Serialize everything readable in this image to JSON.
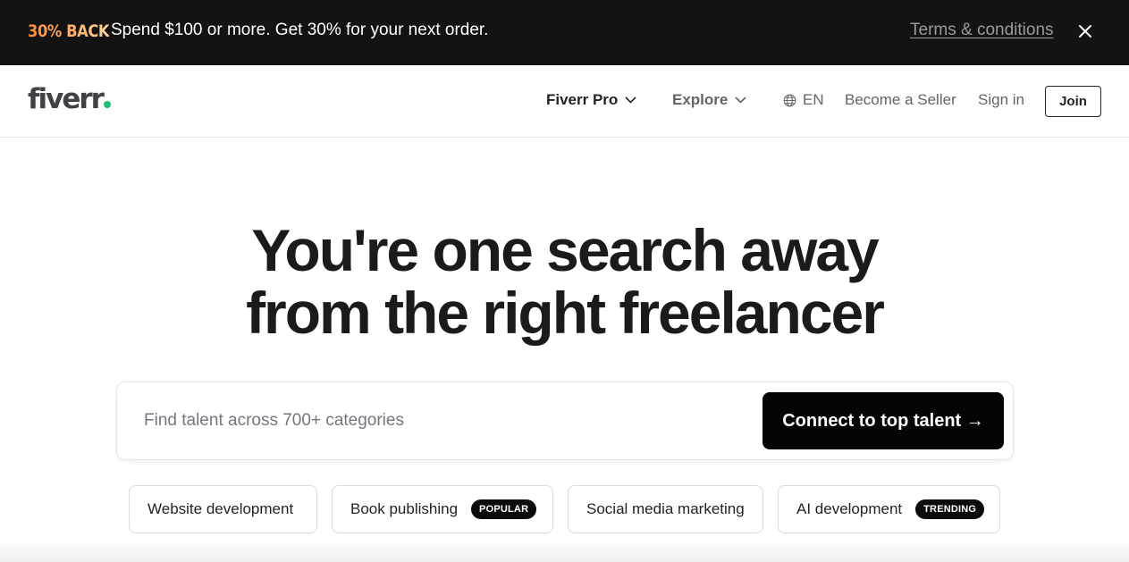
{
  "promo": {
    "badge": "30% BACK",
    "text": "Spend $100 or more. Get 30% for your next order.",
    "terms_link": "Terms & conditions",
    "close_icon": "close-icon"
  },
  "header": {
    "logo": "fiverr",
    "nav": {
      "fiverr_pro": "Fiverr Pro",
      "explore": "Explore",
      "language": "EN",
      "become_seller": "Become a Seller",
      "sign_in": "Sign in",
      "join": "Join"
    }
  },
  "hero": {
    "title_line1": "You're one search away",
    "title_line2": "from the right freelancer"
  },
  "search": {
    "placeholder": "Find talent across 700+ categories",
    "value": "",
    "button_label": "Connect to top talent →"
  },
  "chips": [
    {
      "label": "Website development",
      "badge": ""
    },
    {
      "label": "Book publishing",
      "badge": "POPULAR"
    },
    {
      "label": "Social media marketing",
      "badge": ""
    },
    {
      "label": "AI development",
      "badge": "TRENDING"
    }
  ],
  "colors": {
    "promo_bg": "#131313",
    "brand_green": "#1dbf73",
    "button_dark": "#050505"
  }
}
